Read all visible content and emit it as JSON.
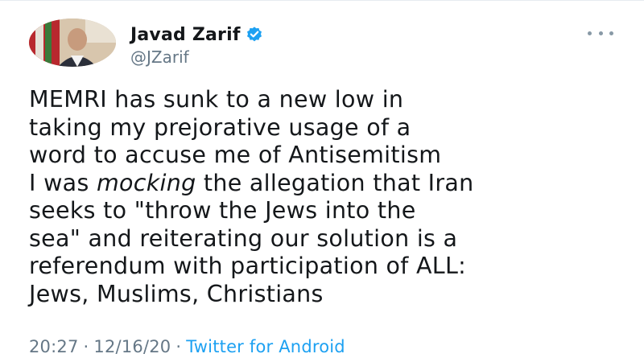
{
  "author": {
    "display_name": "Javad Zarif",
    "handle": "@JZarif",
    "verified": true,
    "avatar_icon": "profile-photo"
  },
  "menu": {
    "more_icon": "more-horizontal-icon"
  },
  "tweet": {
    "line1": "MEMRI has sunk to a new low in",
    "line2": "taking my prejorative usage of a",
    "line3": "word to accuse me of Antisemitism",
    "line4_before": "I was ",
    "line4_italic": "mocking",
    "line4_after": " the allegation that Iran",
    "line5": "seeks to \"throw the Jews into the",
    "line6": "sea\" and reiterating our solution is a",
    "line7": "referendum with participation of ALL:",
    "line8": "Jews, Muslims, Christians"
  },
  "meta": {
    "time": "20:27",
    "separator": "·",
    "date": "12/16/20",
    "source": "Twitter for Android"
  },
  "colors": {
    "text": "#14171a",
    "secondary": "#657786",
    "accent": "#1da1f2"
  }
}
